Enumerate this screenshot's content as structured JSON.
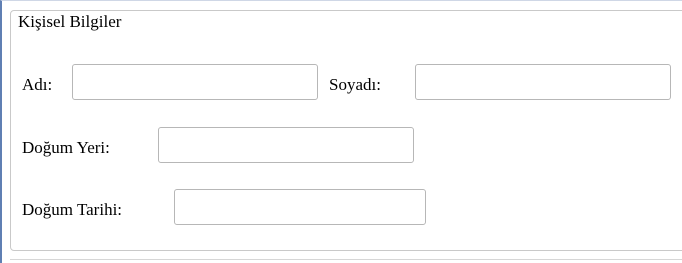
{
  "form": {
    "legend": "Kişisel Bilgiler",
    "fields": {
      "ad": {
        "label": "Adı:",
        "value": "",
        "placeholder": ""
      },
      "soyad": {
        "label": "Soyadı:",
        "value": "",
        "placeholder": ""
      },
      "dogum_yeri": {
        "label": "Doğum Yeri:",
        "value": "",
        "placeholder": ""
      },
      "dogum_tarihi": {
        "label": "Doğum Tarihi:",
        "value": "",
        "placeholder": ""
      }
    }
  },
  "colors": {
    "frame_border": "#5f7fb3",
    "fieldset_border": "#c9c9c9",
    "input_border": "#b7b7b7"
  }
}
